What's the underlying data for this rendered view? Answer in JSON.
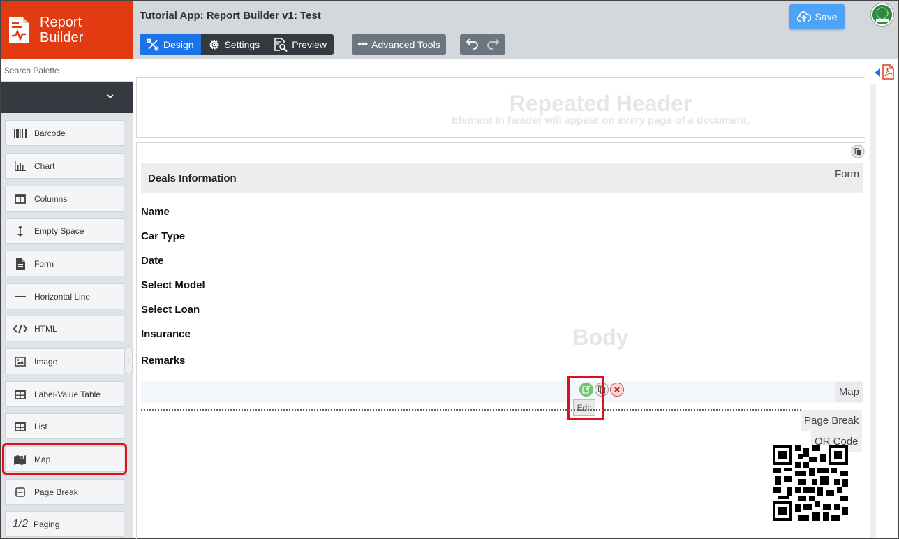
{
  "brand": {
    "line1": "Report",
    "line2": "Builder",
    "color": "#e23a11"
  },
  "topbar": {
    "title": "Tutorial App: Report Builder v1: Test",
    "tabs": [
      {
        "label": "Design",
        "icon": "design-icon",
        "active": true
      },
      {
        "label": "Settings",
        "icon": "gear-icon",
        "active": false
      },
      {
        "label": "Preview",
        "icon": "preview-icon",
        "active": false
      }
    ],
    "advanced_label": "Advanced Tools",
    "save_label": "Save"
  },
  "sidebar": {
    "search_placeholder": "Search Palette",
    "items": [
      {
        "label": "Barcode",
        "icon": "barcode-icon"
      },
      {
        "label": "Chart",
        "icon": "chart-icon"
      },
      {
        "label": "Columns",
        "icon": "columns-icon"
      },
      {
        "label": "Empty Space",
        "icon": "vertical-arrows-icon"
      },
      {
        "label": "Form",
        "icon": "document-icon"
      },
      {
        "label": "Horizontal Line",
        "icon": "minus-icon"
      },
      {
        "label": "HTML",
        "icon": "code-icon"
      },
      {
        "label": "Image",
        "icon": "image-icon"
      },
      {
        "label": "Label-Value Table",
        "icon": "table-icon"
      },
      {
        "label": "List",
        "icon": "list-table-icon"
      },
      {
        "label": "Map",
        "icon": "map-icon",
        "highlighted": true
      },
      {
        "label": "Page Break",
        "icon": "page-break-icon"
      },
      {
        "label": "Paging",
        "icon": "fraction-icon",
        "glyph": "1/2"
      }
    ]
  },
  "canvas": {
    "header": {
      "title": "Repeated Header",
      "subtitle": "Element in header will appear on every page of a document."
    },
    "body": {
      "watermark": "Body",
      "form_title": "Deals Information",
      "form_tag": "Form",
      "fields": [
        "Name",
        "Car Type",
        "Date",
        "Select Model",
        "Select Loan",
        "Insurance",
        "Remarks"
      ],
      "map_tag": "Map",
      "tooltip": "Edit",
      "page_break_tag": "Page Break",
      "qr_tag": "QR Code"
    }
  },
  "colors": {
    "accent": "#1a73e8",
    "dark": "#343a40",
    "highlight": "#e0101a",
    "save": "#4da3f5"
  }
}
